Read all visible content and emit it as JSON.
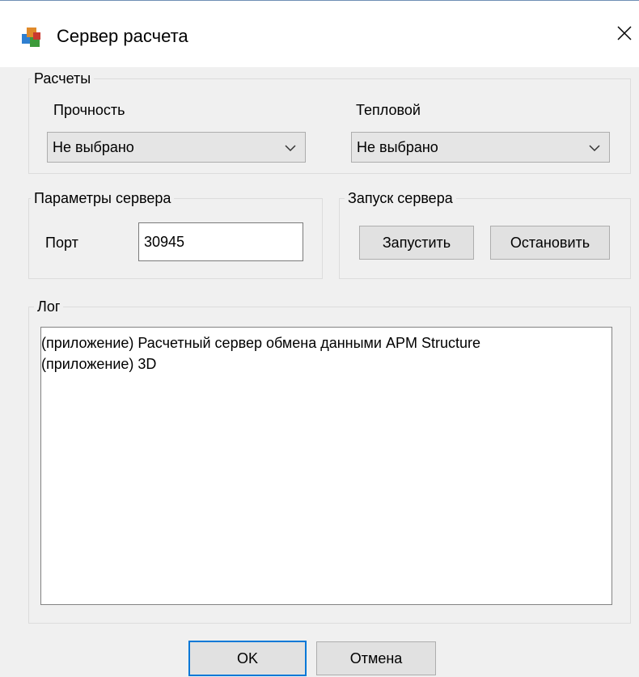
{
  "window": {
    "title": "Сервер расчета",
    "icon": "cubes-app-icon",
    "close_glyph": "✕"
  },
  "calculations": {
    "legend": "Расчеты",
    "strength": {
      "label": "Прочность",
      "selected": "Не выбрано"
    },
    "thermal": {
      "label": "Тепловой",
      "selected": "Не выбрано"
    }
  },
  "server_params": {
    "legend": "Параметры сервера",
    "port_label": "Порт",
    "port_value": "30945"
  },
  "server_launch": {
    "legend": "Запуск сервера",
    "start_label": "Запустить",
    "stop_label": "Остановить"
  },
  "log": {
    "legend": "Лог",
    "lines": [
      "(приложение) Расчетный сервер обмена данными APM Structure",
      "(приложение) 3D"
    ]
  },
  "footer": {
    "ok_label": "OK",
    "cancel_label": "Отмена"
  },
  "colors": {
    "window_bg": "#f0f0f0",
    "accent": "#0078d7",
    "group_border": "#dcdcdc"
  }
}
